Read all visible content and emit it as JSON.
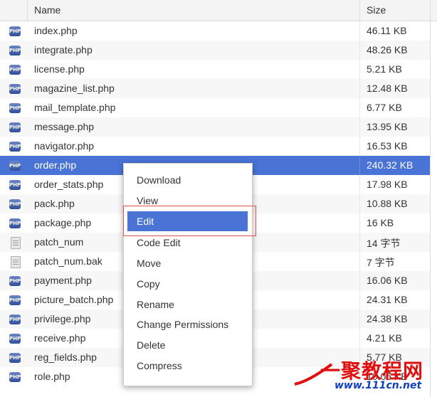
{
  "header": {
    "name_label": "Name",
    "size_label": "Size"
  },
  "rows": [
    {
      "name": "index.php",
      "size": "46.11 KB",
      "icon": "php-file-icon"
    },
    {
      "name": "integrate.php",
      "size": "48.26 KB",
      "icon": "php-file-icon"
    },
    {
      "name": "license.php",
      "size": "5.21 KB",
      "icon": "php-file-icon"
    },
    {
      "name": "magazine_list.php",
      "size": "12.48 KB",
      "icon": "php-file-icon"
    },
    {
      "name": "mail_template.php",
      "size": "6.77 KB",
      "icon": "php-file-icon"
    },
    {
      "name": "message.php",
      "size": "13.95 KB",
      "icon": "php-file-icon"
    },
    {
      "name": "navigator.php",
      "size": "16.53 KB",
      "icon": "php-file-icon"
    },
    {
      "name": "order.php",
      "size": "240.32 KB",
      "icon": "php-file-icon",
      "selected": true
    },
    {
      "name": "order_stats.php",
      "size": "17.98 KB",
      "icon": "php-file-icon"
    },
    {
      "name": "pack.php",
      "size": "10.88 KB",
      "icon": "php-file-icon"
    },
    {
      "name": "package.php",
      "size": "16 KB",
      "icon": "php-file-icon"
    },
    {
      "name": "patch_num",
      "size": "14 字节",
      "icon": "text-file-icon"
    },
    {
      "name": "patch_num.bak",
      "size": "7 字节",
      "icon": "text-file-icon"
    },
    {
      "name": "payment.php",
      "size": "16.06 KB",
      "icon": "php-file-icon"
    },
    {
      "name": "picture_batch.php",
      "size": "24.31 KB",
      "icon": "php-file-icon"
    },
    {
      "name": "privilege.php",
      "size": "24.38 KB",
      "icon": "php-file-icon"
    },
    {
      "name": "receive.php",
      "size": "4.21 KB",
      "icon": "php-file-icon"
    },
    {
      "name": "reg_fields.php",
      "size": "5.77 KB",
      "icon": "php-file-icon"
    },
    {
      "name": "role.php",
      "size": "10.06 KB",
      "icon": "php-file-icon"
    }
  ],
  "context_menu": {
    "items": [
      "Download",
      "View",
      "Edit",
      "Code Edit",
      "Move",
      "Copy",
      "Rename",
      "Change Permissions",
      "Delete",
      "Compress"
    ],
    "active_index": 2
  },
  "icon_text": {
    "php": "PHP"
  },
  "watermark": {
    "title": "一聚教程网",
    "url": "www.111cn.net"
  },
  "colors": {
    "selection": "#4a73d6",
    "highlight_border": "#e05050",
    "watermark_red": "#e01010",
    "watermark_blue": "#1040c0"
  }
}
